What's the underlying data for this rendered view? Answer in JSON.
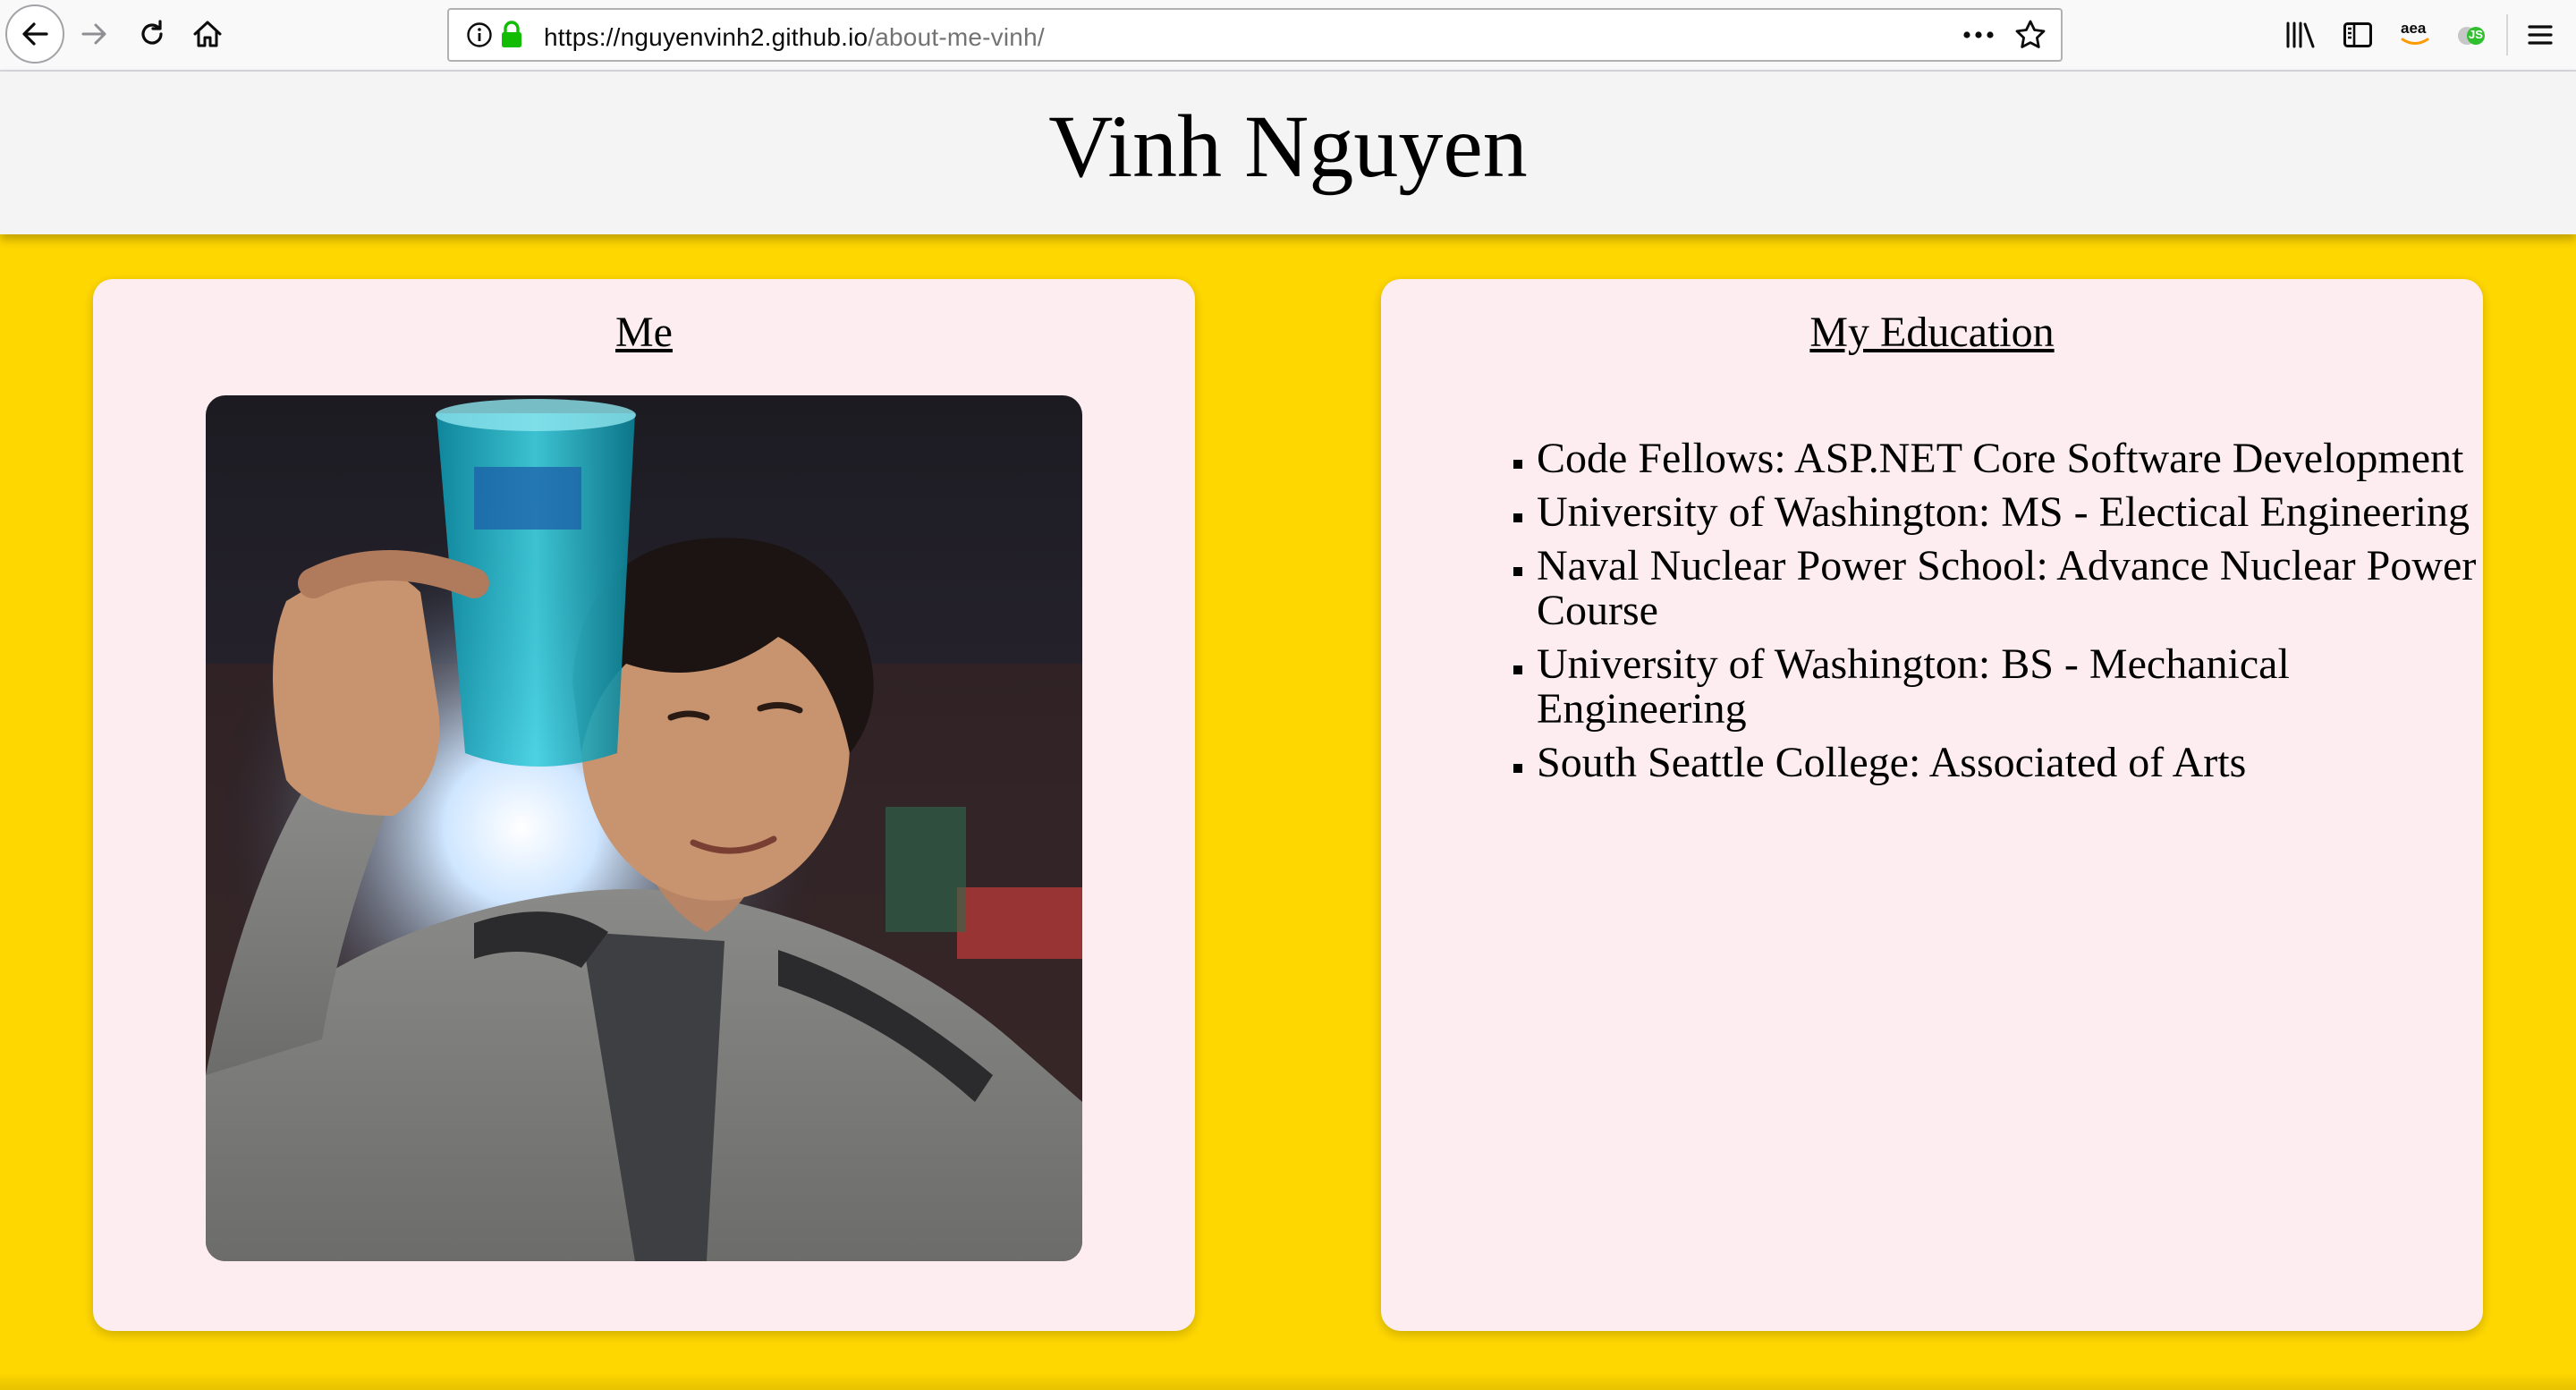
{
  "browser": {
    "url_host": "https://nguyenvinh2.github.io",
    "url_path": "/about-me-vinh/",
    "extension_amazon_label": "aea",
    "extension_js_label": "JS"
  },
  "header": {
    "title": "Vinh Nguyen"
  },
  "me_card": {
    "heading": "Me",
    "photo_alt": "Photo of Vinh holding a glass"
  },
  "education_card": {
    "heading": "My Education",
    "items": [
      {
        "label": "Code Fellows: ASP.NET Core Software Development"
      },
      {
        "label": "University of Washington: MS - Electical Engineering"
      },
      {
        "label": "Naval Nuclear Power School: Advance Nuclear Power Course"
      },
      {
        "label": "University of Washington: BS - Mechanical Engineering"
      },
      {
        "label": "South Seattle College: Associated of Arts"
      }
    ]
  },
  "colors": {
    "page_background": "#ffd700",
    "header_background": "#f4f4f4",
    "card_background": "#fdedf1",
    "secure_lock": "#12bc00"
  }
}
